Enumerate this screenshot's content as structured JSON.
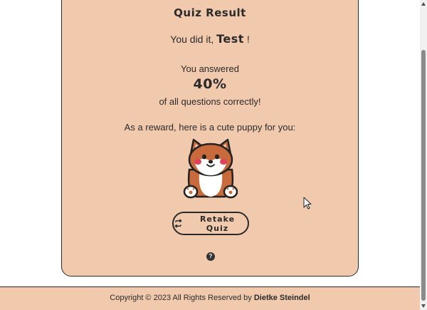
{
  "result": {
    "title": "Quiz Result",
    "greeting_prefix": "You did it, ",
    "user_name": "Test",
    "greeting_suffix": " !",
    "answered_label": "You answered",
    "score": "40%",
    "correct_label": "of all questions correctly!",
    "reward_text": "As a reward, here is a cute puppy for you:",
    "retake_label": "Retake Quiz",
    "help_label": "?"
  },
  "footer": {
    "copyright": "Copyright © 2023 All Rights Reserved by ",
    "author": "Dietke Steindel"
  },
  "icons": {
    "puppy": "puppy-illustration",
    "retake": "refresh-icon",
    "help": "question-mark-icon",
    "cursor": "mouse-pointer-icon"
  },
  "colors": {
    "card_background": "#f1c9ad",
    "border": "#2a2a2a",
    "page_background": "#ffffff"
  }
}
